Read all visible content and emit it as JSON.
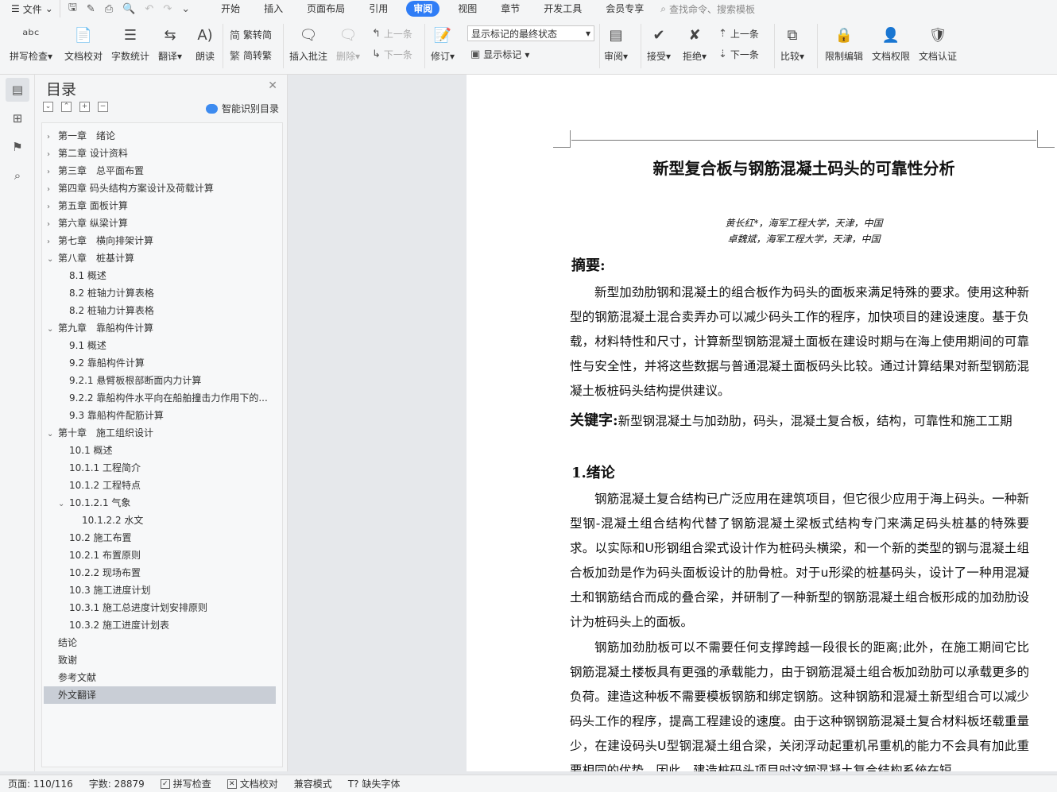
{
  "menubar": {
    "file_label": "文件",
    "tabs": [
      "开始",
      "插入",
      "页面布局",
      "引用",
      "审阅",
      "视图",
      "章节",
      "开发工具",
      "会员专享"
    ],
    "active_tab": "审阅",
    "search_placeholder": "查找命令、搜索模板"
  },
  "ribbon": {
    "spell_check": "拼写检查",
    "doc_proof": "文档校对",
    "word_count": "字数统计",
    "translate": "翻译",
    "read_aloud": "朗读",
    "trad_to_simp": "繁转简",
    "simp_to_trad": "简转繁",
    "insert_comment": "插入批注",
    "delete": "删除",
    "prev_comment": "上一条",
    "next_comment": "下一条",
    "revise": "修订",
    "show_markup_select": "显示标记的最终状态",
    "show_markup": "显示标记",
    "review": "审阅",
    "accept": "接受",
    "reject": "拒绝",
    "prev_change": "上一条",
    "next_change": "下一条",
    "compare": "比较",
    "restrict_edit": "限制编辑",
    "doc_permission": "文档权限",
    "doc_cert": "文档认证"
  },
  "toc": {
    "title": "目录",
    "smart_label": "智能识别目录",
    "items": [
      {
        "text": "第一章　绪论",
        "arrow": "›"
      },
      {
        "text": "第二章  设计资料",
        "arrow": "›"
      },
      {
        "text": "第三章　总平面布置",
        "arrow": "›"
      },
      {
        "text": "第四章  码头结构方案设计及荷载计算",
        "arrow": "›"
      },
      {
        "text": "第五章  面板计算",
        "arrow": "›"
      },
      {
        "text": "第六章  纵梁计算",
        "arrow": "›"
      },
      {
        "text": "第七章　横向排架计算",
        "arrow": "›"
      },
      {
        "text": "第八章　桩基计算",
        "arrow": "⌄"
      },
      {
        "text": "8.1 概述",
        "arrow": ""
      },
      {
        "text": "8.2 桩轴力计算表格",
        "arrow": ""
      },
      {
        "text": "8.2 桩轴力计算表格",
        "arrow": ""
      },
      {
        "text": "第九章　靠船构件计算",
        "arrow": "⌄"
      },
      {
        "text": "9.1 概述",
        "arrow": ""
      },
      {
        "text": "9.2 靠船构件计算",
        "arrow": ""
      },
      {
        "text": "9.2.1 悬臂板根部断面内力计算",
        "arrow": ""
      },
      {
        "text": "9.2.2 靠船构件水平向在船舶撞击力作用下的...",
        "arrow": ""
      },
      {
        "text": "9.3 靠船构件配筋计算",
        "arrow": ""
      },
      {
        "text": "第十章　施工组织设计",
        "arrow": "⌄"
      },
      {
        "text": "10.1  概述",
        "arrow": ""
      },
      {
        "text": "10.1.1  工程简介",
        "arrow": ""
      },
      {
        "text": "10.1.2  工程特点",
        "arrow": ""
      },
      {
        "text": "10.1.2.1  气象",
        "arrow": "⌄"
      },
      {
        "text": "10.1.2.2  水文",
        "arrow": ""
      },
      {
        "text": "10.2  施工布置",
        "arrow": ""
      },
      {
        "text": "10.2.1 布置原则",
        "arrow": ""
      },
      {
        "text": "10.2.2  现场布置",
        "arrow": ""
      },
      {
        "text": "10.3  施工进度计划",
        "arrow": ""
      },
      {
        "text": "10.3.1 施工总进度计划安排原则",
        "arrow": ""
      },
      {
        "text": "10.3.2 施工进度计划表",
        "arrow": ""
      },
      {
        "text": "结论",
        "arrow": ""
      },
      {
        "text": "致谢",
        "arrow": ""
      },
      {
        "text": "参考文献",
        "arrow": ""
      },
      {
        "text": "外文翻译",
        "arrow": ""
      }
    ]
  },
  "document": {
    "title": "新型复合板与钢筋混凝土码头的可靠性分析",
    "author1": "黄长红*，海军工程大学，天津，中国",
    "author2": "卓魏斌，海军工程大学，天津，中国",
    "abstract_heading": "摘要:",
    "abstract": "新型加劲肋钢和混凝土的组合板作为码头的面板来满足特殊的要求。使用这种新型的钢筋混凝土混合卖弄办可以减少码头工作的程序，加快项目的建设速度。基于负载，材料特性和尺寸，计算新型钢筋混凝土面板在建设时期与在海上使用期间的可靠性与安全性，并将这些数据与普通混凝土面板码头比较。通过计算结果对新型钢筋混凝土板桩码头结构提供建议。",
    "keywords_label": "关键字:",
    "keywords": "新型钢混凝土与加劲肋，码头，混凝土复合板，结构，可靠性和施工工期",
    "section1_heading": "1.绪论",
    "para1": "钢筋混凝土复合结构已广泛应用在建筑项目，但它很少应用于海上码头。一种新型钢-混凝土组合结构代替了钢筋混凝土梁板式结构专门来满足码头桩基的特殊要求。以实际和U形钢组合梁式设计作为桩码头横梁，和一个新的类型的钢与混凝土组合板加劲是作为码头面板设计的肋骨桩。对于u形梁的桩基码头，设计了一种用混凝土和钢筋结合而成的叠合梁，并研制了一种新型的钢筋混凝土组合板形成的加劲肋设计为桩码头上的面板。",
    "para2": "钢筋加劲肋板可以不需要任何支撑跨越一段很长的距离;此外，在施工期间它比钢筋混凝土楼板具有更强的承载能力，由于钢筋混凝土组合板加劲肋可以承载更多的负荷。建造这种板不需要模板钢筋和绑定钢筋。这种钢筋和混凝土新型组合可以减少码头工作的程序，提高工程建设的速度。由于这种钢钢筋混凝土复合材料板坯载重量少，在建设码头U型钢混凝土组合梁，关闭浮动起重机吊重机的能力不会具有加此重要相同的优势。因此，建造桩码头项目时这钢混凝土复合结构系统在短"
  },
  "status": {
    "page": "页面: 110/116",
    "words": "字数: 28879",
    "spell": "拼写检查",
    "proof": "文档校对",
    "compat": "兼容模式",
    "missing_font": "缺失字体"
  }
}
